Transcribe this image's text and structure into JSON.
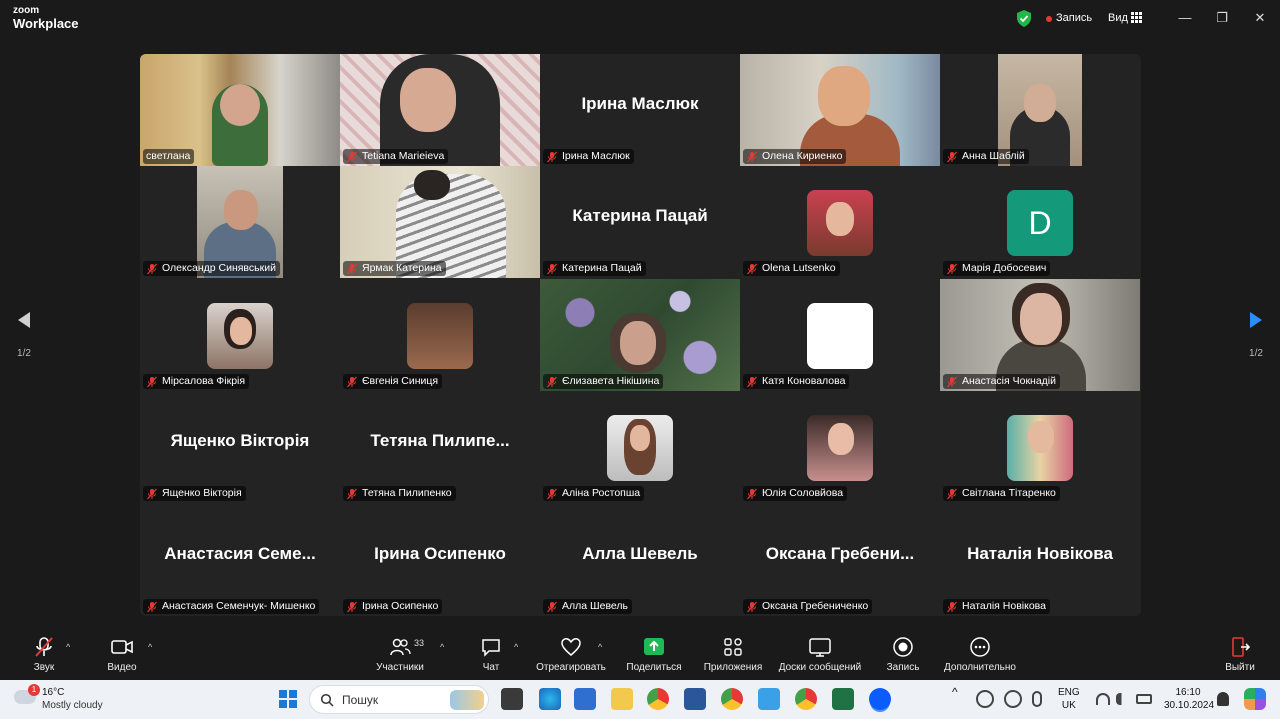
{
  "app": {
    "logo_line1": "zoom",
    "logo_line2": "Workplace"
  },
  "titlebar": {
    "record_label": "Запись",
    "view_label": "Вид",
    "minimize": "—",
    "restore": "❐",
    "close": "✕"
  },
  "navigation": {
    "left_page": "1/2",
    "right_page": "1/2"
  },
  "participants": [
    {
      "name": "светлана",
      "display": "",
      "muted": false,
      "active": true
    },
    {
      "name": "Tetiana Marieieva",
      "display": "",
      "muted": true
    },
    {
      "name": "Ірина Маслюк",
      "display": "Ірина Маслюк",
      "muted": true
    },
    {
      "name": "Олена Кириенко",
      "display": "",
      "muted": true
    },
    {
      "name": "Анна Шаблій",
      "display": "",
      "muted": true
    },
    {
      "name": "Олександр Синявський",
      "display": "",
      "muted": true
    },
    {
      "name": "Ярмак Катерина",
      "display": "",
      "muted": true
    },
    {
      "name": "Катерина Пацай",
      "display": "Катерина Пацай",
      "muted": true
    },
    {
      "name": "Olena Lutsenko",
      "display": "",
      "muted": true
    },
    {
      "name": "Марія Добосевич",
      "display": "",
      "avatar_letter": "D",
      "muted": true
    },
    {
      "name": "Мірсалова Фікрія",
      "display": "",
      "muted": true
    },
    {
      "name": "Євгенія Синиця",
      "display": "",
      "muted": true
    },
    {
      "name": "Єлизавета Нікішина",
      "display": "",
      "muted": true
    },
    {
      "name": "Катя Коновалова",
      "display": "",
      "muted": true
    },
    {
      "name": "Анастасія Чокнадій",
      "display": "",
      "muted": true
    },
    {
      "name": "Ященко Вікторія",
      "display": "Ященко Вікторія",
      "muted": true
    },
    {
      "name": "Тетяна Пилипенко",
      "display": "Тетяна  Пилипе...",
      "muted": true
    },
    {
      "name": "Аліна Ростопша",
      "display": "",
      "muted": true
    },
    {
      "name": "Юлія Соловйова",
      "display": "",
      "muted": true
    },
    {
      "name": "Світлана Тітаренко",
      "display": "",
      "muted": true
    },
    {
      "name": "Анастасия Семенчук- Мишенко",
      "display": "Анастасия  Семе...",
      "muted": true
    },
    {
      "name": "Ірина Осипенко",
      "display": "Ірина Осипенко",
      "muted": true
    },
    {
      "name": "Алла Шевель",
      "display": "Алла Шевель",
      "muted": true
    },
    {
      "name": "Оксана Гребениченко",
      "display": "Оксана  Гребени...",
      "muted": true
    },
    {
      "name": "Наталія Новікова",
      "display": "Наталія Новікова",
      "muted": true
    }
  ],
  "toolbar": {
    "audio": "Звук",
    "video": "Видео",
    "participants": "Участники",
    "participants_count": "33",
    "chat": "Чат",
    "react": "Отреагировать",
    "share": "Поделиться",
    "apps": "Приложения",
    "whiteboards": "Доски сообщений",
    "record": "Запись",
    "more": "Дополнительно",
    "leave": "Выйти"
  },
  "taskbar": {
    "temp": "16°C",
    "weather": "Mostly cloudy",
    "weather_badge": "1",
    "search_placeholder": "Пошук",
    "lang1": "ENG",
    "lang2": "UK",
    "time": "16:10",
    "date": "30.10.2024"
  },
  "colors": {
    "active_border": "#31d16b",
    "share_green": "#1db954",
    "muted_red": "#e53935",
    "avatar_teal": "#149a7a"
  }
}
